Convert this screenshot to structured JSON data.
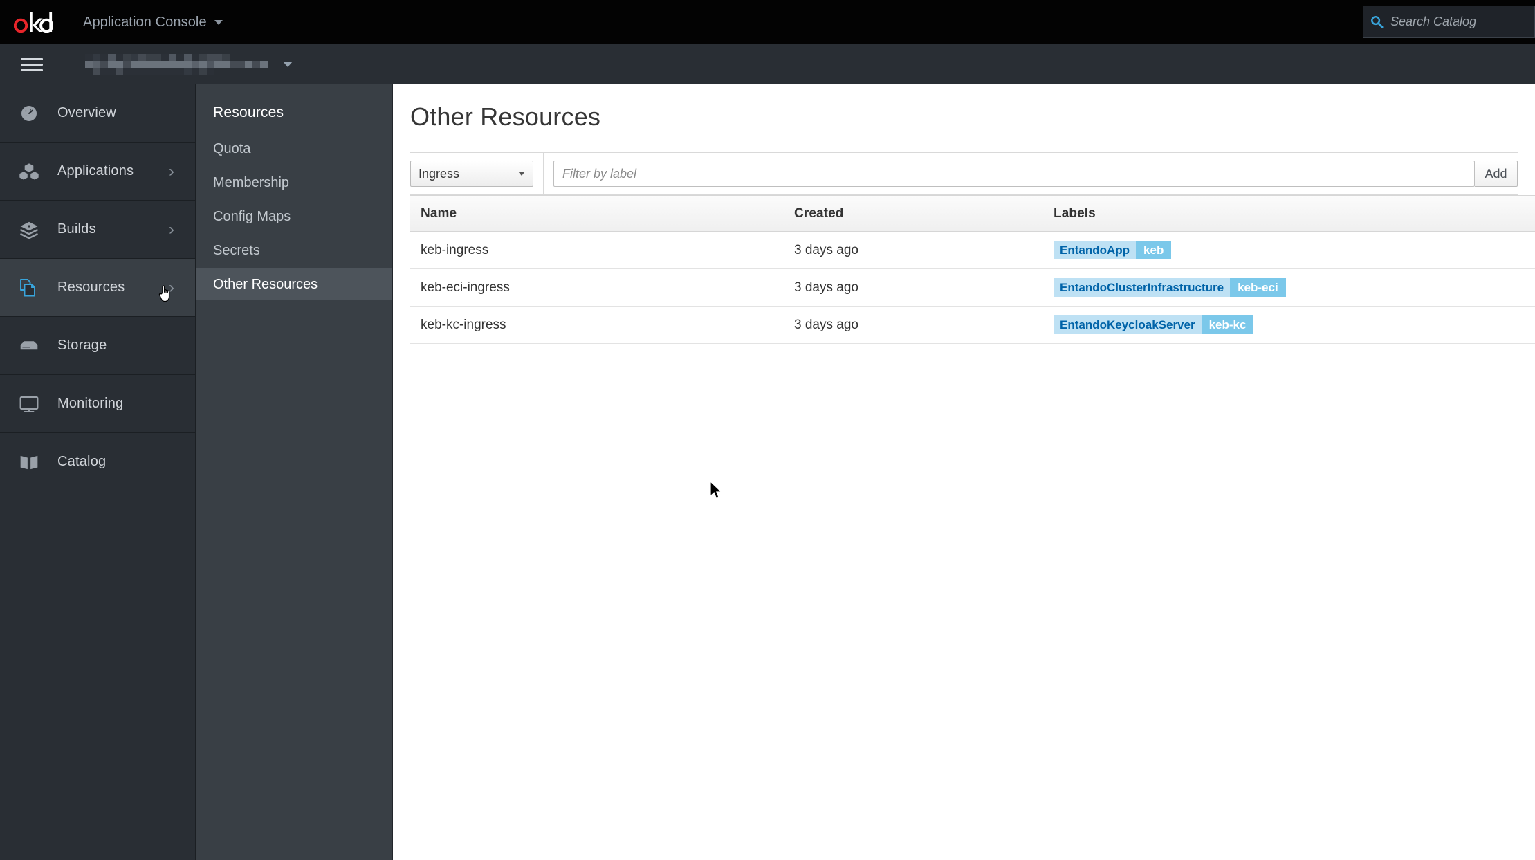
{
  "masthead": {
    "logo_text": "okd",
    "console_label": "Application Console",
    "console_caret_icon": "chevron-down-icon",
    "search": {
      "placeholder": "Search Catalog",
      "value": "",
      "icon": "search-icon",
      "icon_color": "#39a5dc"
    },
    "background": "#030303"
  },
  "projectbar": {
    "hamburger_icon": "hamburger-menu-icon",
    "project_name": "",
    "project_caret_icon": "chevron-down-icon",
    "background": "#292e34"
  },
  "sidebar": {
    "active_color": "#39a5dc",
    "items": [
      {
        "label": "Overview",
        "icon": "dashboard-icon",
        "active": false,
        "chevron": false
      },
      {
        "label": "Applications",
        "icon": "cubes-icon",
        "active": false,
        "chevron": true
      },
      {
        "label": "Builds",
        "icon": "layers-icon",
        "active": false,
        "chevron": true
      },
      {
        "label": "Resources",
        "icon": "documents-icon",
        "active": true,
        "chevron": true
      },
      {
        "label": "Storage",
        "icon": "storage-icon",
        "active": false,
        "chevron": false
      },
      {
        "label": "Monitoring",
        "icon": "monitor-icon",
        "active": false,
        "chevron": false
      },
      {
        "label": "Catalog",
        "icon": "book-icon",
        "active": false,
        "chevron": false
      }
    ]
  },
  "secondary_nav": {
    "heading": "Resources",
    "items": [
      {
        "label": "Quota",
        "active": false
      },
      {
        "label": "Membership",
        "active": false
      },
      {
        "label": "Config Maps",
        "active": false
      },
      {
        "label": "Secrets",
        "active": false
      },
      {
        "label": "Other Resources",
        "active": true
      }
    ]
  },
  "main": {
    "title": "Other Resources",
    "filter": {
      "kind_selected": "Ingress",
      "kind_caret_icon": "chevron-down-icon",
      "label_placeholder": "Filter by label",
      "label_value": "",
      "add_label": "Add"
    },
    "table": {
      "columns": [
        "Name",
        "Created",
        "Labels"
      ],
      "rows": [
        {
          "name": "keb-ingress",
          "created": "3 days ago",
          "labels": [
            {
              "key": "EntandoApp",
              "value": "keb"
            }
          ]
        },
        {
          "name": "keb-eci-ingress",
          "created": "3 days ago",
          "labels": [
            {
              "key": "EntandoClusterInfrastructure",
              "value": "keb-eci"
            }
          ]
        },
        {
          "name": "keb-kc-ingress",
          "created": "3 days ago",
          "labels": [
            {
              "key": "EntandoKeycloakServer",
              "value": "keb-kc"
            }
          ]
        }
      ]
    },
    "label_colors": {
      "key_bg": "#bee1f4",
      "key_fg": "#0063a8",
      "value_bg": "#7bc8ea",
      "value_fg": "#ffffff"
    }
  }
}
